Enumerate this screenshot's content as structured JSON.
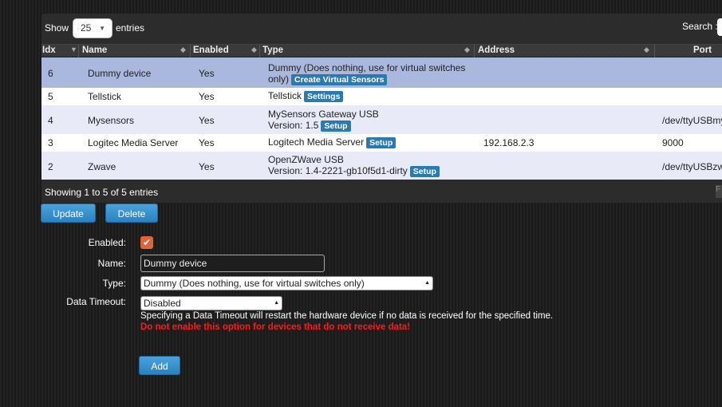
{
  "table": {
    "show_label": "Show",
    "page_size": "25",
    "entries_label": "entries",
    "search_label": "Search :",
    "columns": [
      "Idx",
      "Name",
      "Enabled",
      "Type",
      "Address",
      "Port"
    ],
    "rows": [
      {
        "idx": "6",
        "name": "Dummy device",
        "enabled": "Yes",
        "type_line1": "Dummy (Does nothing, use for virtual switches",
        "type_line2": "only)",
        "action": "Create Virtual Sensors",
        "address": "",
        "port": ""
      },
      {
        "idx": "5",
        "name": "Tellstick",
        "enabled": "Yes",
        "type_line1": "Tellstick",
        "type_line2": "",
        "action": "Settings",
        "address": "",
        "port": ""
      },
      {
        "idx": "4",
        "name": "Mysensors",
        "enabled": "Yes",
        "type_line1": "MySensors Gateway USB",
        "type_line2": "Version: 1.5",
        "action": "Setup",
        "address": "",
        "port": "/dev/ttyUSBmy"
      },
      {
        "idx": "3",
        "name": "Logitec Media Server",
        "enabled": "Yes",
        "type_line1": "Logitech Media Server",
        "type_line2": "",
        "action": "Setup",
        "address": "192.168.2.3",
        "port": "9000"
      },
      {
        "idx": "2",
        "name": "Zwave",
        "enabled": "Yes",
        "type_line1": "OpenZWave USB",
        "type_line2": "Version: 1.4-2221-gb10f5d1-dirty",
        "action": "Setup",
        "address": "",
        "port": "/dev/ttyUSBzw"
      }
    ],
    "footer_info": "Showing 1 to 5 of 5 entries",
    "pager_fragment": "F"
  },
  "buttons": {
    "update": "Update",
    "delete": "Delete",
    "add": "Add"
  },
  "form": {
    "enabled_label": "Enabled:",
    "enabled_checked": true,
    "name_label": "Name:",
    "name_value": "Dummy device",
    "type_label": "Type:",
    "type_value": "Dummy (Does nothing, use for virtual switches only)",
    "timeout_label": "Data Timeout:",
    "timeout_value": "Disabled",
    "timeout_note": "Specifying a Data Timeout will restart the hardware device if no data is received for the specified time.",
    "timeout_warning": "Do not enable this option for devices that do not receive data!"
  },
  "colors": {
    "row_selected": "#aab8dd",
    "row_alt": "#e8eaf8",
    "row_white": "#ffffff",
    "button_blue": "#2c80bf",
    "warning": "#ff1a1a",
    "check": "#e0633a"
  }
}
